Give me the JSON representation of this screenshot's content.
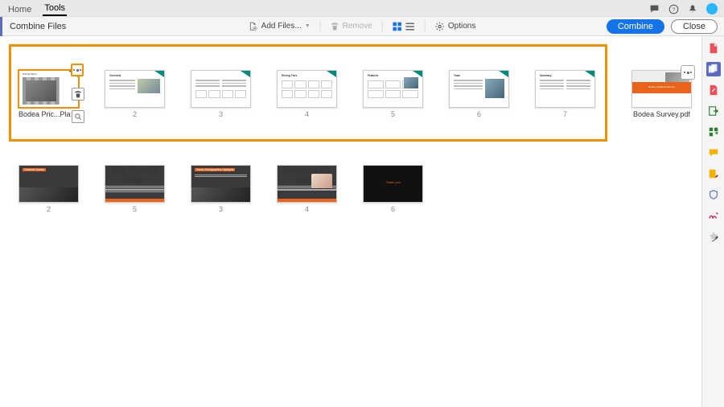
{
  "tabs": {
    "home": "Home",
    "tools": "Tools"
  },
  "toolbar": {
    "title": "Combine Files",
    "addFiles": "Add Files...",
    "remove": "Remove",
    "options": "Options",
    "combine": "Combine",
    "close": "Close"
  },
  "selection": {
    "file": "Bodea Pric...Plans.ppt",
    "pages": [
      "2",
      "3",
      "4",
      "5",
      "6",
      "7"
    ]
  },
  "surveyFile": "Bodea Survey.pdf",
  "row2": {
    "pages": [
      "2",
      "5",
      "3",
      "4",
      "6"
    ]
  },
  "slide": {
    "p1_title": "Pricing Plans",
    "p2_title": "Overview",
    "p4_title": "Pricing Tiers",
    "p5_title": "Features",
    "p6_title": "Team",
    "p7_title": "Summary",
    "r2a": "Customer Survey",
    "r2b": "Key Special Offers",
    "r2c": "Survey Demographics Highlights",
    "r2d": "Reasons for Joining",
    "r2e": "Thank you"
  },
  "survey_txt": "Bodea Customer Survey"
}
